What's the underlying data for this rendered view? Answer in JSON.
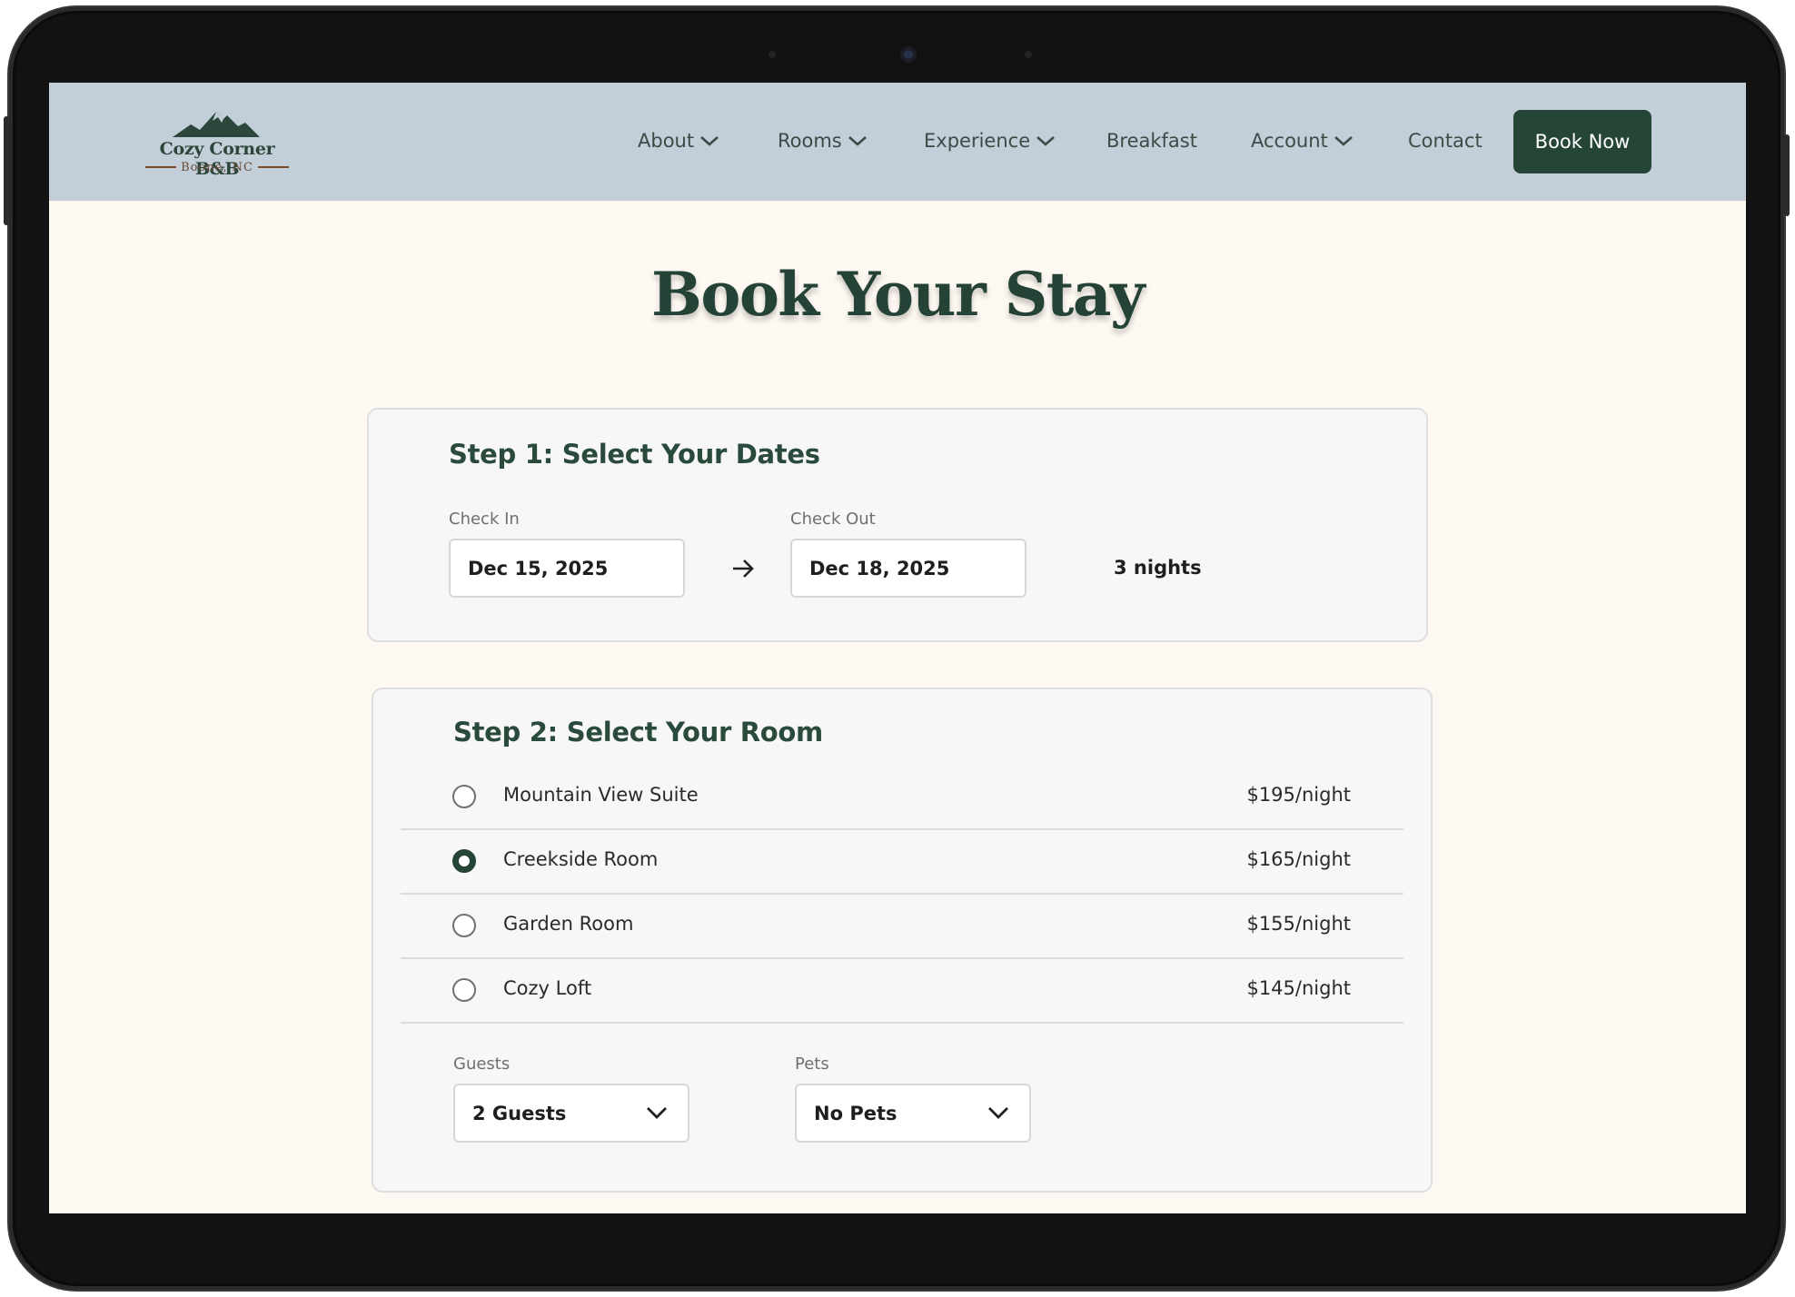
{
  "brand": {
    "name": "Cozy Corner B&B",
    "location": "Boone, NC"
  },
  "nav": {
    "items": [
      {
        "label": "About",
        "dropdown": true
      },
      {
        "label": "Rooms",
        "dropdown": true
      },
      {
        "label": "Experience",
        "dropdown": true
      },
      {
        "label": "Breakfast",
        "dropdown": false
      },
      {
        "label": "Account",
        "dropdown": true
      },
      {
        "label": "Contact",
        "dropdown": false
      }
    ],
    "cta_label": "Book Now"
  },
  "page": {
    "title": "Book Your Stay"
  },
  "step1": {
    "title": "Step 1: Select Your Dates",
    "check_in_label": "Check In",
    "check_in_value": "Dec 15, 2025",
    "check_out_label": "Check Out",
    "check_out_value": "Dec 18, 2025",
    "nights": "3 nights"
  },
  "step2": {
    "title": "Step 2: Select Your Room",
    "rooms": [
      {
        "name": "Mountain View Suite",
        "price": "$195/night",
        "selected": false
      },
      {
        "name": "Creekside Room",
        "price": "$165/night",
        "selected": true
      },
      {
        "name": "Garden Room",
        "price": "$155/night",
        "selected": false
      },
      {
        "name": "Cozy Loft",
        "price": "$145/night",
        "selected": false
      }
    ],
    "guests_label": "Guests",
    "guests_value": "2 Guests",
    "pets_label": "Pets",
    "pets_value": "No Pets"
  },
  "colors": {
    "brand_green": "#254637",
    "nav_background": "#c2ced8",
    "page_background": "#fdf8f1"
  },
  "icons": {
    "logo": "mountain-icon",
    "dropdown": "chevron-down-icon",
    "date_arrow": "arrow-right-icon",
    "radio": "radio-icon"
  }
}
